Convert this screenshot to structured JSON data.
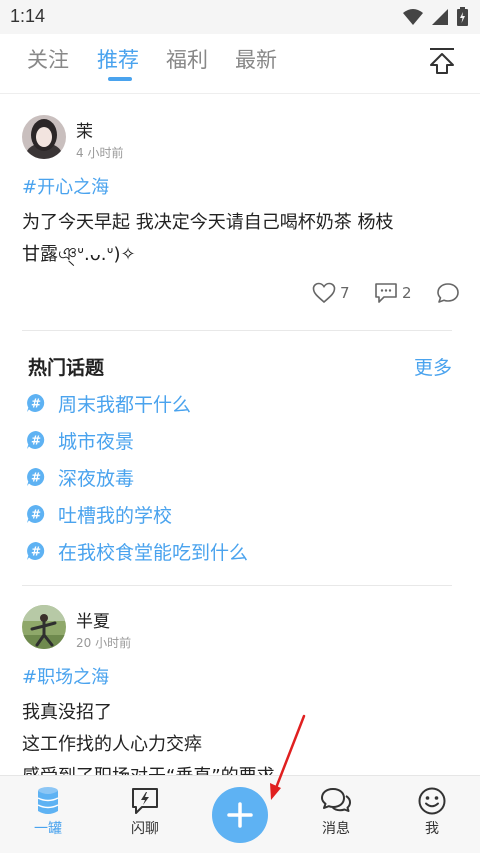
{
  "status_bar": {
    "time": "1:14"
  },
  "tabs": [
    {
      "label": "关注"
    },
    {
      "label": "推荐"
    },
    {
      "label": "福利"
    },
    {
      "label": "最新"
    }
  ],
  "posts": [
    {
      "username": "茉",
      "time": "4 小时前",
      "tag": "#开心之海",
      "lines": [
        "为了今天早起  我决定今天请自己喝杯奶茶   杨枝",
        "甘露ঞ্ᐡ.ᴗ.ᐡ)✧"
      ],
      "likes": "7",
      "comments": "2"
    },
    {
      "username": "半夏",
      "time": "20 小时前",
      "tag": "#职场之海",
      "lines": [
        "我真没招了",
        "这工作找的人心力交瘁",
        "感受到了职场对于“垂直”的要求"
      ]
    }
  ],
  "hot_topics": {
    "title": "热门话题",
    "more": "更多",
    "items": [
      "周末我都干什么",
      "城市夜景",
      "深夜放毒",
      "吐槽我的学校",
      "在我校食堂能吃到什么"
    ]
  },
  "bottom_nav": [
    {
      "label": "一罐",
      "icon": "jar-icon"
    },
    {
      "label": "闪聊",
      "icon": "flash-chat-icon"
    },
    {
      "label": "",
      "icon": "plus-icon"
    },
    {
      "label": "消息",
      "icon": "message-icon"
    },
    {
      "label": "我",
      "icon": "smiley-icon"
    }
  ],
  "colors": {
    "accent": "#4aa3ee",
    "fab": "#5eb2f3",
    "arrow": "#e02020"
  }
}
